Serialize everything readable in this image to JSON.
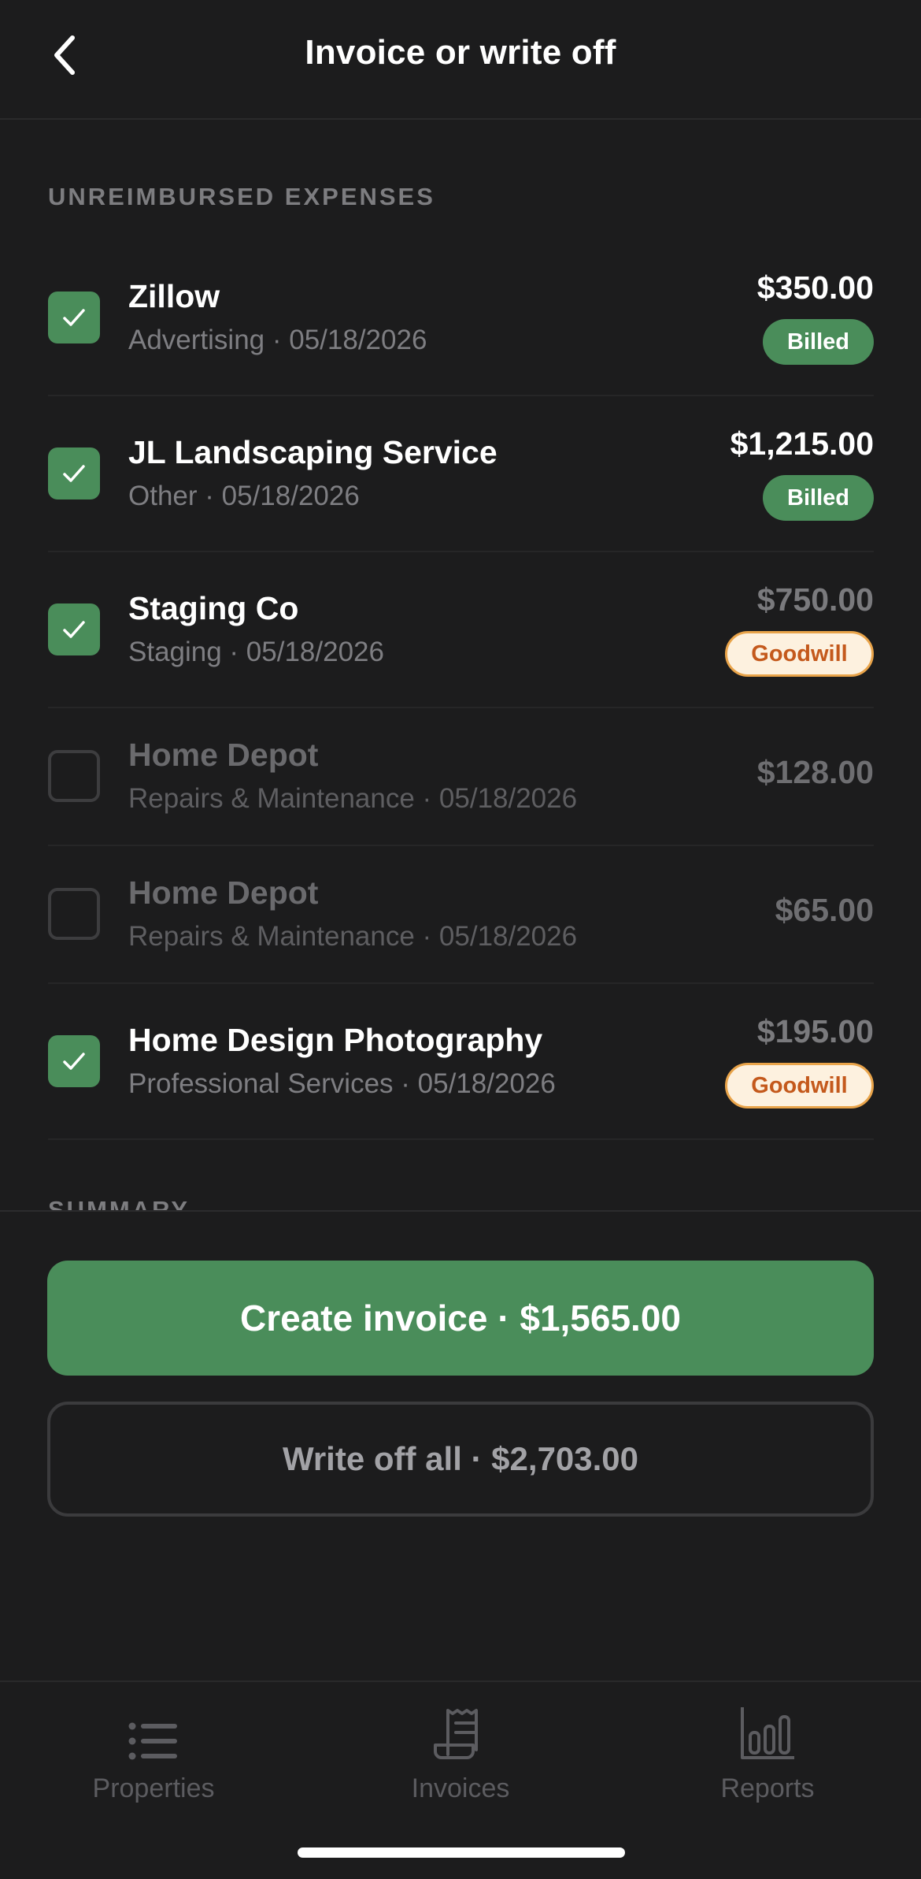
{
  "header": {
    "title": "Invoice or write off"
  },
  "section": {
    "label": "UNREIMBURSED EXPENSES"
  },
  "expenses": [
    {
      "name": "Zillow",
      "meta": "Advertising · 05/18/2026",
      "amount": "$350.00",
      "badge": "Billed",
      "checked": true
    },
    {
      "name": "JL Landscaping Service",
      "meta": "Other · 05/18/2026",
      "amount": "$1,215.00",
      "badge": "Billed",
      "checked": true
    },
    {
      "name": "Staging Co",
      "meta": "Staging · 05/18/2026",
      "amount": "$750.00",
      "badge": "Goodwill",
      "checked": true
    },
    {
      "name": "Home Depot",
      "meta": "Repairs & Maintenance · 05/18/2026",
      "amount": "$128.00",
      "badge": "",
      "checked": false
    },
    {
      "name": "Home Depot",
      "meta": "Repairs & Maintenance · 05/18/2026",
      "amount": "$65.00",
      "badge": "",
      "checked": false
    },
    {
      "name": "Home Design Photography",
      "meta": "Professional Services · 05/18/2026",
      "amount": "$195.00",
      "badge": "Goodwill",
      "checked": true
    }
  ],
  "summary": {
    "label": "SUMMARY"
  },
  "actions": {
    "create_invoice": "Create invoice · $1,565.00",
    "write_off_all": "Write off all · $2,703.00"
  },
  "tabs": [
    {
      "label": "Properties",
      "icon": "list-icon"
    },
    {
      "label": "Invoices",
      "icon": "receipt-icon"
    },
    {
      "label": "Reports",
      "icon": "bar-chart-icon"
    }
  ],
  "colors": {
    "background": "#1c1c1d",
    "accent_green": "#4a8d5a",
    "goodwill_bg": "#fdf1df",
    "goodwill_text": "#c4591c",
    "goodwill_border": "#e9a44a"
  }
}
